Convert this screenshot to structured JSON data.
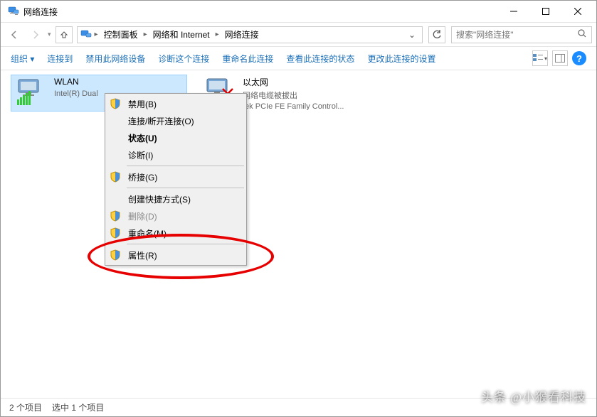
{
  "window": {
    "title": "网络连接"
  },
  "breadcrumb": {
    "items": [
      "控制面板",
      "网络和 Internet",
      "网络连接"
    ]
  },
  "search": {
    "placeholder": "搜索\"网络连接\""
  },
  "toolbar": {
    "organize": "组织 ▾",
    "items": [
      "连接到",
      "禁用此网络设备",
      "诊断这个连接",
      "重命名此连接",
      "查看此连接的状态",
      "更改此连接的设置"
    ]
  },
  "adapters": [
    {
      "name": "WLAN",
      "status": "",
      "driver": "Intel(R) Dual",
      "selected": true
    },
    {
      "name": "以太网",
      "status": "网络电缆被拔出",
      "driver": "tek PCIe FE Family Control...",
      "selected": false
    }
  ],
  "contextMenu": {
    "items": [
      {
        "label": "禁用(B)",
        "shield": true,
        "bold": false,
        "disabled": false
      },
      {
        "label": "连接/断开连接(O)",
        "shield": false,
        "bold": false,
        "disabled": false
      },
      {
        "label": "状态(U)",
        "shield": false,
        "bold": true,
        "disabled": false
      },
      {
        "label": "诊断(I)",
        "shield": false,
        "bold": false,
        "disabled": false
      },
      {
        "sep": true
      },
      {
        "label": "桥接(G)",
        "shield": true,
        "bold": false,
        "disabled": false
      },
      {
        "sep": true
      },
      {
        "label": "创建快捷方式(S)",
        "shield": false,
        "bold": false,
        "disabled": false
      },
      {
        "label": "删除(D)",
        "shield": true,
        "bold": false,
        "disabled": true
      },
      {
        "label": "重命名(M)",
        "shield": true,
        "bold": false,
        "disabled": false
      },
      {
        "sep": true
      },
      {
        "label": "属性(R)",
        "shield": true,
        "bold": false,
        "disabled": false
      }
    ]
  },
  "statusbar": {
    "count": "2 个项目",
    "selection": "选中 1 个项目"
  },
  "watermark": "头条 @小猴看科技"
}
